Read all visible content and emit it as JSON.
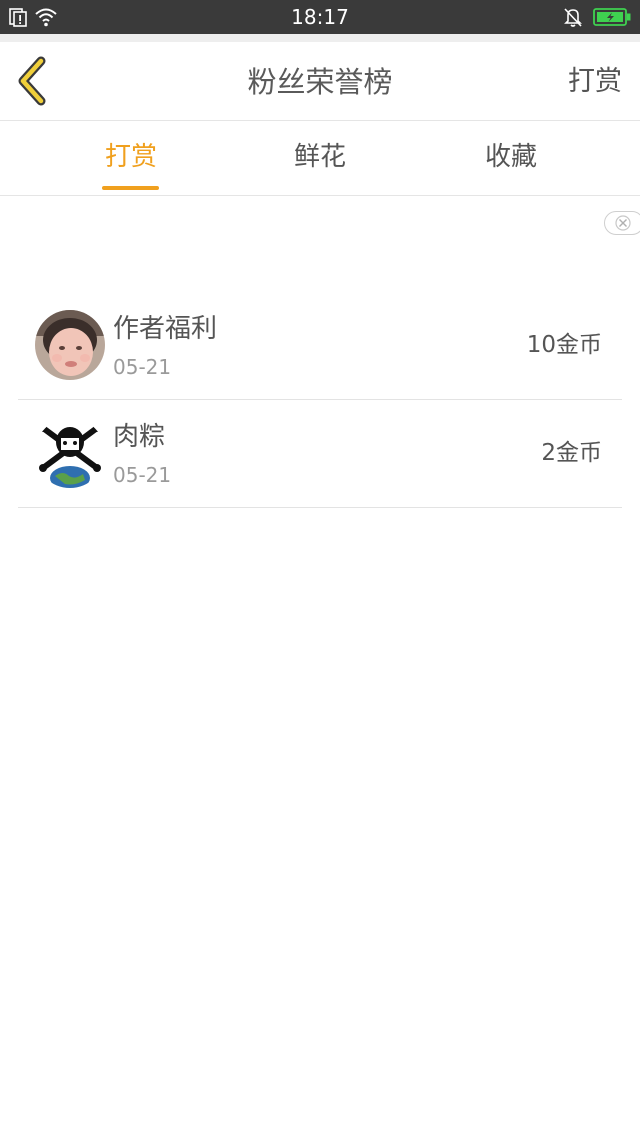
{
  "status_bar": {
    "time": "18:17"
  },
  "header": {
    "title": "粉丝荣誉榜",
    "action_label": "打赏"
  },
  "tabs": [
    {
      "label": "打赏",
      "active": true
    },
    {
      "label": "鲜花",
      "active": false
    },
    {
      "label": "收藏",
      "active": false
    }
  ],
  "list": [
    {
      "name": "作者福利",
      "date": "05-21",
      "amount": "10金币"
    },
    {
      "name": "肉粽",
      "date": "05-21",
      "amount": "2金币"
    }
  ],
  "colors": {
    "accent": "#f0a01e",
    "status_bar": "#3a3a3a",
    "text_primary": "#555555",
    "text_secondary": "#9a9a9a",
    "battery": "#3fd150"
  },
  "icons": {
    "back": "chevron-left-icon",
    "close": "close-icon",
    "wifi": "wifi-icon",
    "sim": "sim-alert-icon",
    "bell": "bell-off-icon",
    "battery": "battery-charging-icon"
  }
}
